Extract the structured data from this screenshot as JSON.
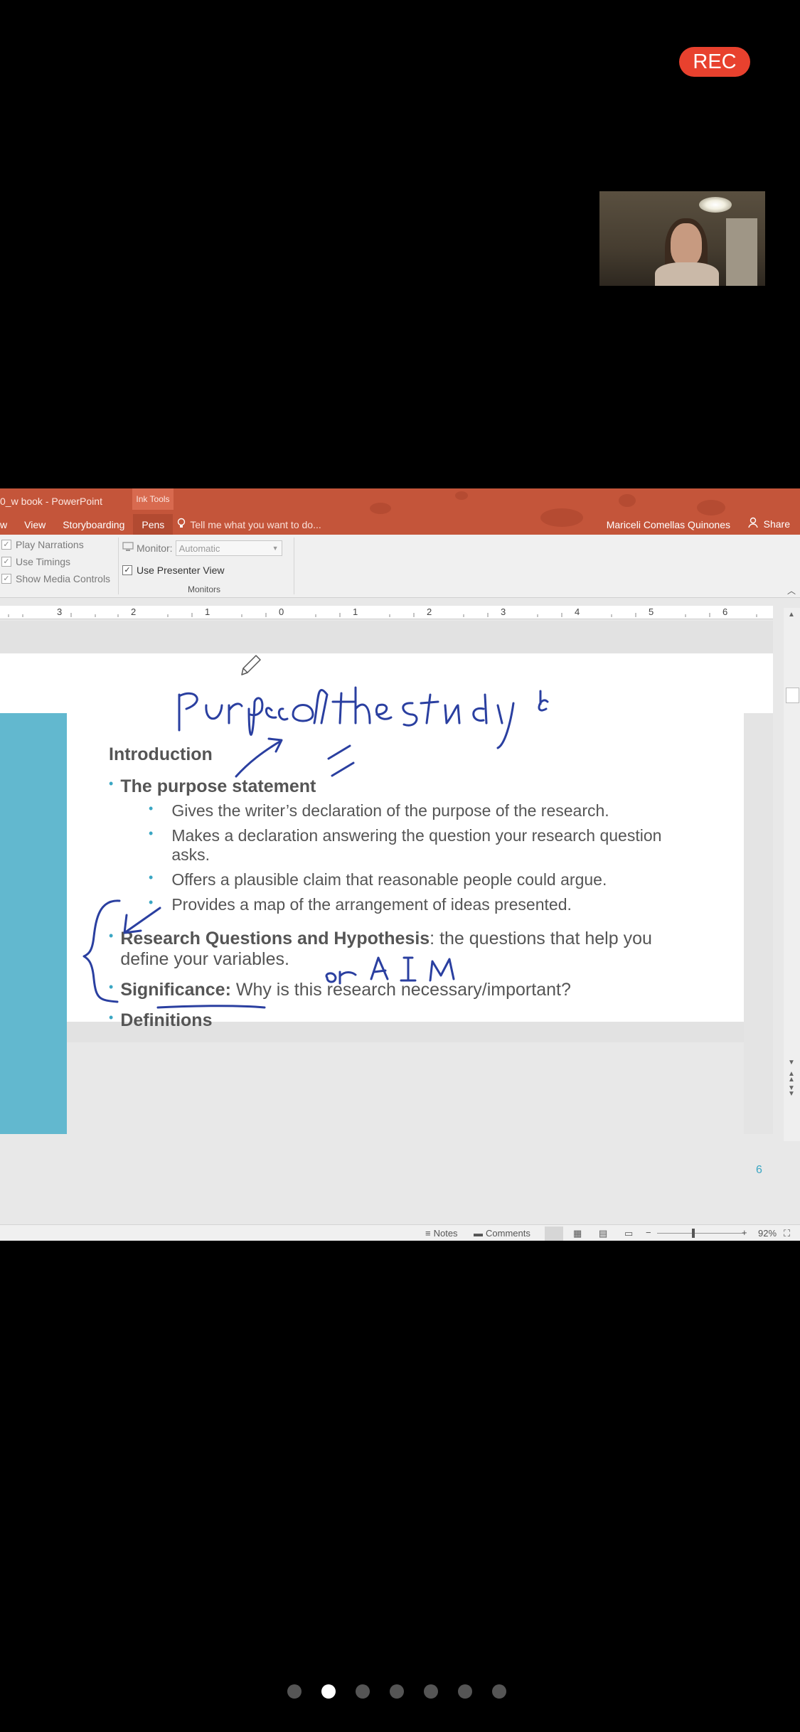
{
  "recording": {
    "label": "REC"
  },
  "powerpoint": {
    "window_title": "0_w book - PowerPoint",
    "contextual_tab": "Ink Tools",
    "tabs": [
      "w",
      "View",
      "Storyboarding",
      "Pens"
    ],
    "active_tab": "Pens",
    "tell_me": "Tell me what you want to do...",
    "user_name": "Mariceli Comellas Quinones",
    "share_label": "Share",
    "ribbon": {
      "checkboxes": [
        "Play Narrations",
        "Use Timings",
        "Show Media Controls"
      ],
      "monitor_label": "Monitor:",
      "monitor_value": "Automatic",
      "presenter_view_label": "Use Presenter View",
      "group_label": "Monitors"
    },
    "ruler_numbers": [
      "3",
      "2",
      "1",
      "0",
      "1",
      "2",
      "3",
      "4",
      "5",
      "6"
    ],
    "slide": {
      "heading": "Introduction",
      "items": [
        {
          "level": 1,
          "bold": "The purpose statement",
          "rest": ""
        },
        {
          "level": 2,
          "bold": "",
          "rest": "Gives the writer’s declaration of the purpose of the research."
        },
        {
          "level": 2,
          "bold": "",
          "rest": "Makes a declaration answering the question your research  question asks."
        },
        {
          "level": 2,
          "bold": "",
          "rest": "Offers a plausible claim that reasonable people could argue."
        },
        {
          "level": 2,
          "bold": "",
          "rest": "Provides a map of the arrangement of ideas presented."
        },
        {
          "level": 1,
          "bold": "Research Questions and Hypothesis",
          "rest": ": the questions that help you define your variables."
        },
        {
          "level": 1,
          "bold": "Significance:",
          "rest": " Why is this research necessary/important?"
        },
        {
          "level": 1,
          "bold": "Definitions",
          "rest": ""
        }
      ],
      "page_number": "6"
    },
    "status": {
      "notes_label": "Notes",
      "comments_label": "Comments",
      "zoom": "92%"
    }
  },
  "pagination": {
    "total": 7,
    "active_index": 1
  }
}
